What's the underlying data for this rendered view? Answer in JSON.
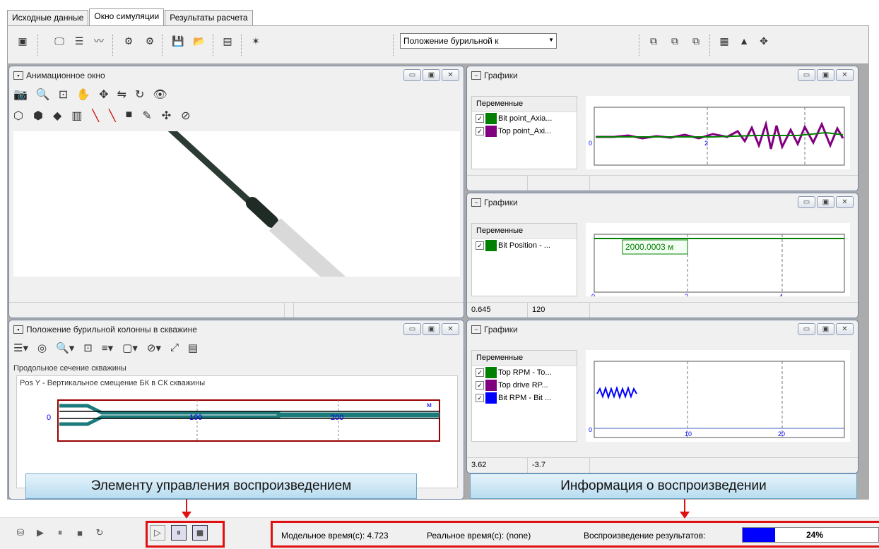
{
  "tabs": [
    {
      "label": "Исходные данные"
    },
    {
      "label": "Окно симуляции"
    },
    {
      "label": "Результаты расчета"
    }
  ],
  "toolbar": {
    "dropdown_value": "Положение бурильной к"
  },
  "anim": {
    "title": "Анимационное окно"
  },
  "g1": {
    "title": "Графики",
    "header": "Переменные",
    "items": [
      {
        "label": "Bit point_Axia...",
        "color": "#008000"
      },
      {
        "label": "Top point_Axi...",
        "color": "#800080"
      }
    ],
    "ytick0": "0",
    "xtick": "2"
  },
  "g2": {
    "title": "Графики",
    "header": "Переменные",
    "items": [
      {
        "label": "Bit Position - ...",
        "color": "#008000"
      }
    ],
    "annotation": "2000.0003 м",
    "xticks": [
      "0",
      "2",
      "4"
    ],
    "status": [
      "0.645",
      "120"
    ]
  },
  "g3": {
    "title": "Графики",
    "header": "Переменные",
    "items": [
      {
        "label": "Top RPM - To...",
        "color": "#008000"
      },
      {
        "label": "Top drive RP...",
        "color": "#800080"
      },
      {
        "label": "Bit RPM - Bit ...",
        "color": "#0000ff"
      }
    ],
    "ytick0": "0",
    "xticks": [
      "10",
      "20"
    ],
    "status": [
      "3.62",
      "-3.7"
    ]
  },
  "pos": {
    "title": "Положение бурильной колонны в скважине",
    "section": "Продольное сечение скважины",
    "subsection": "Pos Y - Вертикальное смещение БК в СК скважины",
    "unit": "м",
    "ticks": [
      "0",
      "100",
      "200"
    ]
  },
  "callouts": {
    "left": "Элементу управления воспроизведением",
    "right": "Информация о воспроизведении"
  },
  "playback": {
    "model_time": "Модельное время(с): 4.723",
    "real_time": "Реальное время(с): (none)",
    "results_label": "Воспроизведение результатов:",
    "progress": 0.24,
    "progress_text": "24%"
  },
  "colors": {
    "accent": "#e01010",
    "frame": "#6f86a8",
    "progress": "#0000ff"
  }
}
